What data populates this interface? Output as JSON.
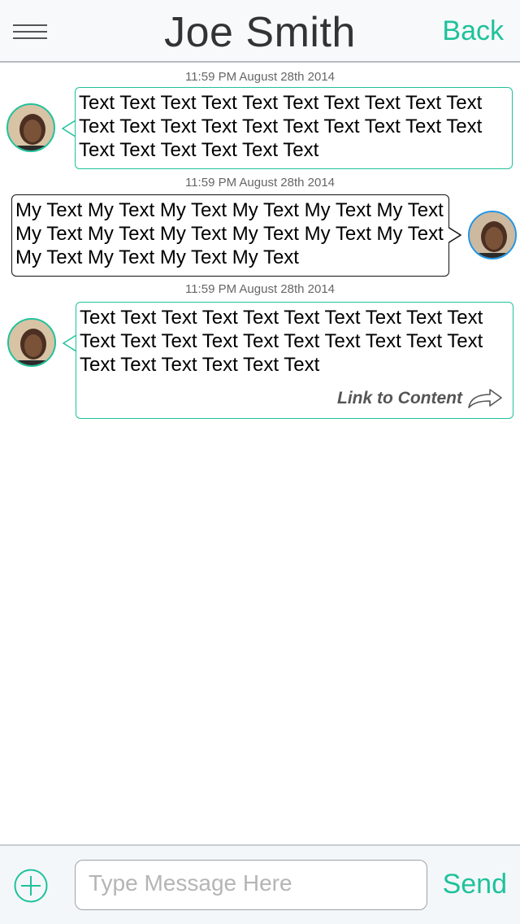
{
  "header": {
    "title": "Joe Smith",
    "back_label": "Back"
  },
  "messages": [
    {
      "timestamp": "11:59 PM August 28th 2014",
      "direction": "incoming",
      "text": "Text Text Text Text Text Text Text Text Text Text Text Text Text Text Text Text Text Text Text Text Text Text Text Text Text Text"
    },
    {
      "timestamp": "11:59 PM August 28th 2014",
      "direction": "outgoing",
      "text": "My Text My Text My Text My Text My Text My Text My Text My Text My Text My Text My Text My Text My Text My Text My Text My Text"
    },
    {
      "timestamp": "11:59 PM August 28th 2014",
      "direction": "incoming",
      "text": "Text Text Text Text Text Text Text Text Text Text Text Text Text Text Text Text Text Text Text Text Text Text Text Text Text Text",
      "link_label": "Link to Content"
    }
  ],
  "composer": {
    "placeholder": "Type Message Here",
    "send_label": "Send"
  },
  "colors": {
    "accent": "#1fc29b",
    "outgoing_avatar_ring": "#2196e8"
  }
}
